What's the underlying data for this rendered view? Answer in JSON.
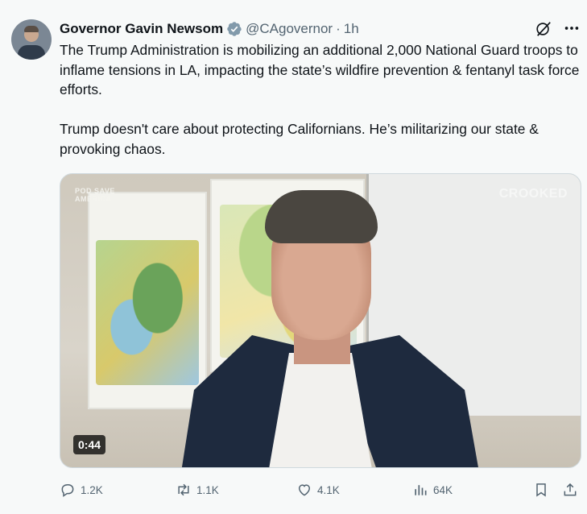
{
  "author": {
    "name": "Governor Gavin Newsom",
    "handle": "@CAgovernor",
    "separator": "·",
    "time": "1h"
  },
  "tweet": {
    "paragraphs": [
      "The Trump Administration is mobilizing an additional 2,000 National Guard troops to inflame tensions in LA, impacting the state’s wildfire prevention & fentanyl task force efforts.",
      "Trump doesn't care about protecting Californians. He’s militarizing our state & provoking chaos."
    ]
  },
  "media": {
    "watermark_left": "POD SAVE\nAMERICA",
    "watermark_right": "CROOKED",
    "duration": "0:44"
  },
  "actions": {
    "replies": "1.2K",
    "reposts": "1.1K",
    "likes": "4.1K",
    "views": "64K"
  },
  "icons": {
    "verified": "verified-badge-icon",
    "grok": "grok-icon",
    "more": "more-icon",
    "reply": "reply-icon",
    "repost": "repost-icon",
    "like": "heart-icon",
    "views": "views-icon",
    "bookmark": "bookmark-icon",
    "share": "share-icon"
  },
  "colors": {
    "text": "#0f1419",
    "muted": "#536471",
    "verified": "#829aab",
    "background": "#f7f9f9"
  }
}
